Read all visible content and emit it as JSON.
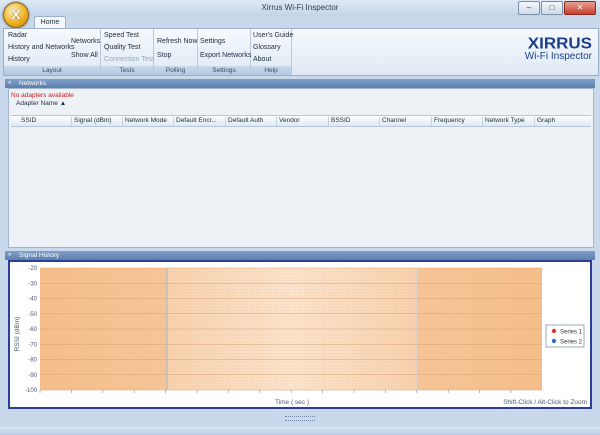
{
  "window": {
    "title": "Xirrus Wi-Fi Inspector",
    "app_icon": "X"
  },
  "window_buttons": {
    "minimize": "–",
    "maximize": "□",
    "close": "✕"
  },
  "tabs": [
    "Home"
  ],
  "ribbon": {
    "layout": {
      "label": "Layout",
      "items": [
        "Radar",
        "History and Networks",
        "History",
        "Networks",
        "Show All"
      ]
    },
    "tests": {
      "label": "Tests",
      "items": [
        "Speed Test",
        "Quality Test",
        "Connection Test"
      ]
    },
    "polling": {
      "label": "Polling",
      "items": [
        "Refresh Now",
        "Stop"
      ]
    },
    "settings": {
      "label": "Settings",
      "items": [
        "Settings",
        "Export Networks"
      ]
    },
    "help": {
      "label": "Help",
      "items": [
        "User's Guide",
        "Glossary",
        "About"
      ]
    }
  },
  "brand": {
    "logo": "XIRRUS",
    "subtitle": "Wi-Fi Inspector"
  },
  "networks_panel": {
    "title": "Networks",
    "message": "No adapters available",
    "adapter_header": "Adapter Name ▲",
    "columns": [
      "SSID",
      "Signal (dBm)",
      "Network Mode",
      "Default Encr...",
      "Default Auth",
      "Vendor",
      "BSSID",
      "Channel",
      "Frequency",
      "Network Type",
      "Graph"
    ]
  },
  "signal_panel": {
    "title": "Signal History",
    "hint": "Shift-Click / Alt-Click to Zoom"
  },
  "chart_data": {
    "type": "line",
    "title": "",
    "xlabel": "Time ( sec )",
    "ylabel": "RSSI (dBm)",
    "ylim": [
      -100,
      -20
    ],
    "yticks": [
      -20,
      -30,
      -40,
      -50,
      -60,
      -70,
      -80,
      -90,
      -100
    ],
    "series": [
      {
        "name": "Series 1",
        "color": "#d0392b",
        "values": []
      },
      {
        "name": "Series 2",
        "color": "#2e6fc0",
        "values": []
      }
    ],
    "legend": "right",
    "grid": true
  },
  "colors": {
    "accent": "#2b3f9a",
    "panel_header": "#6a8bb6",
    "plot_fill": "#f7c79c",
    "brand": "#1b3e8a"
  }
}
